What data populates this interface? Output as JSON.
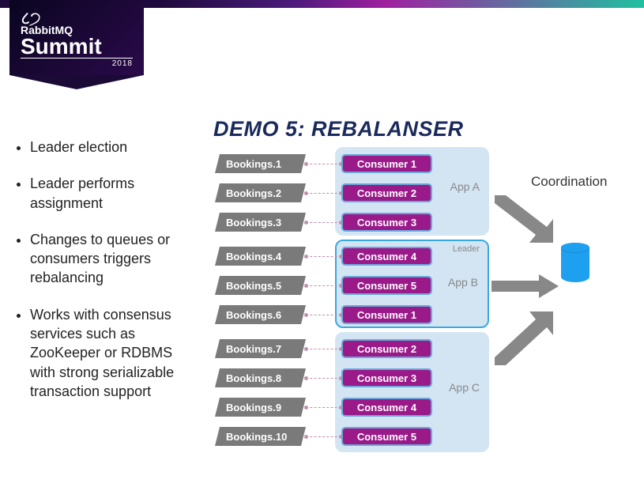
{
  "logo": {
    "brand": "RabbitMQ",
    "event": "Summit",
    "year": "2018"
  },
  "title": "DEMO 5: REBALANSER",
  "bullets": [
    "Leader election",
    "Leader performs assignment",
    "Changes to queues or consumers triggers rebalancing",
    "Works with consensus services such as ZooKeeper or RDBMS with strong serializable transaction support"
  ],
  "queues": [
    "Bookings.1",
    "Bookings.2",
    "Bookings.3",
    "Bookings.4",
    "Bookings.5",
    "Bookings.6",
    "Bookings.7",
    "Bookings.8",
    "Bookings.9",
    "Bookings.10"
  ],
  "consumers": [
    "Consumer 1",
    "Consumer 2",
    "Consumer 3",
    "Consumer 4",
    "Consumer 5",
    "Consumer 1",
    "Consumer 2",
    "Consumer 3",
    "Consumer 4",
    "Consumer 5"
  ],
  "apps": {
    "a": {
      "label": "App A",
      "leader": false
    },
    "b": {
      "label": "App B",
      "leader": true,
      "leaderLabel": "Leader"
    },
    "c": {
      "label": "App C",
      "leader": false
    }
  },
  "coordination": "Coordination"
}
